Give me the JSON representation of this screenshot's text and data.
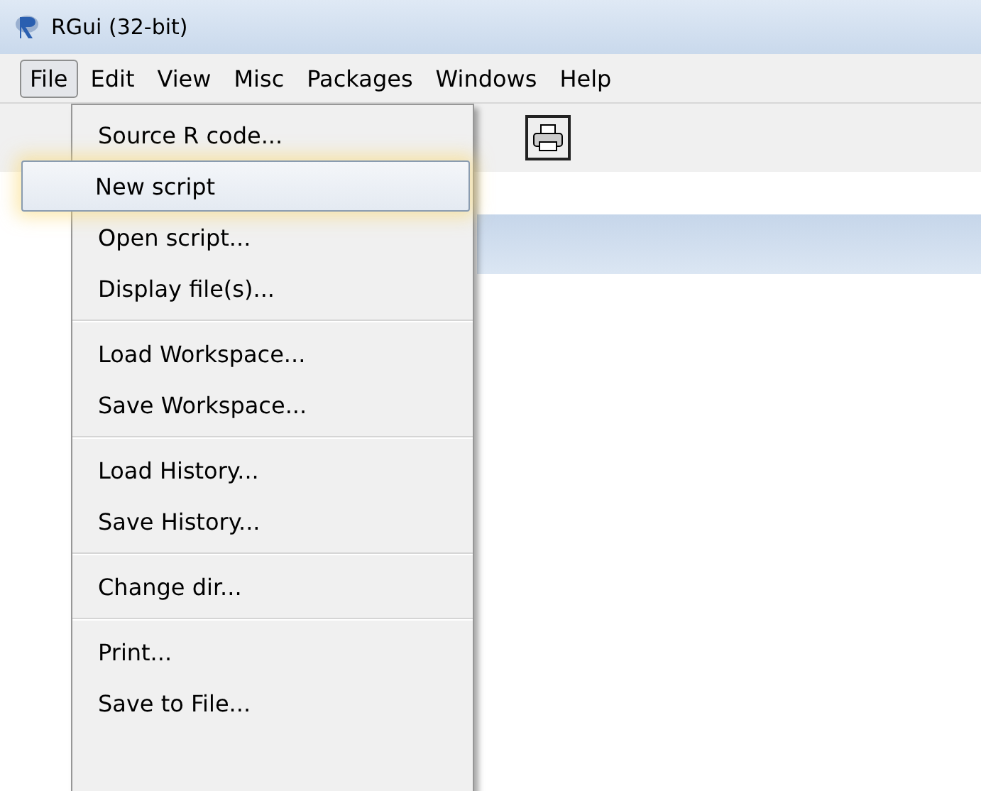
{
  "window": {
    "title": "RGui (32-bit)"
  },
  "menubar": [
    {
      "label": "File",
      "selected": true
    },
    {
      "label": "Edit",
      "selected": false
    },
    {
      "label": "View",
      "selected": false
    },
    {
      "label": "Misc",
      "selected": false
    },
    {
      "label": "Packages",
      "selected": false
    },
    {
      "label": "Windows",
      "selected": false
    },
    {
      "label": "Help",
      "selected": false
    }
  ],
  "file_menu": [
    {
      "kind": "item",
      "label": "Source R code...",
      "selected": false
    },
    {
      "kind": "item",
      "label": "New script",
      "selected": true
    },
    {
      "kind": "item",
      "label": "Open script...",
      "selected": false
    },
    {
      "kind": "item",
      "label": "Display file(s)...",
      "selected": false
    },
    {
      "kind": "separator"
    },
    {
      "kind": "item",
      "label": "Load Workspace...",
      "selected": false
    },
    {
      "kind": "item",
      "label": "Save Workspace...",
      "selected": false
    },
    {
      "kind": "separator"
    },
    {
      "kind": "item",
      "label": "Load History...",
      "selected": false
    },
    {
      "kind": "item",
      "label": "Save History...",
      "selected": false
    },
    {
      "kind": "separator"
    },
    {
      "kind": "item",
      "label": "Change dir...",
      "selected": false
    },
    {
      "kind": "separator"
    },
    {
      "kind": "item",
      "label": "Print...",
      "selected": false
    },
    {
      "kind": "item",
      "label": "Save to File...",
      "selected": false
    }
  ]
}
